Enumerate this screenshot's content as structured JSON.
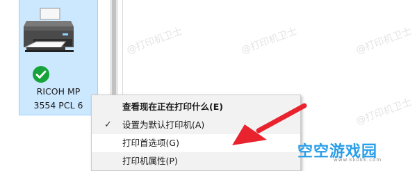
{
  "device": {
    "name_line1": "RICOH MP",
    "name_line2": "3554 PCL 6",
    "status": "default-check",
    "icon": "printer-icon"
  },
  "context_menu": {
    "items": [
      {
        "label": "查看现在正在打印什么(E)",
        "bold": true,
        "checked": false
      },
      {
        "label": "设置为默认打印机(A)",
        "bold": false,
        "checked": true
      },
      {
        "label": "打印首选项(G)",
        "bold": false,
        "checked": false
      },
      {
        "label": "打印机属性(P)",
        "bold": false,
        "checked": false
      }
    ]
  },
  "watermark": "@打印机卫士",
  "logo": {
    "text": "空空游戏园",
    "sub": "www.kkokk.com"
  },
  "colors": {
    "selection": "#cce8ff",
    "arrow": "#e8232e",
    "check_badge": "#16a33a",
    "logo_blue": "#2a9ee8",
    "logo_orange": "#f58a1f"
  }
}
